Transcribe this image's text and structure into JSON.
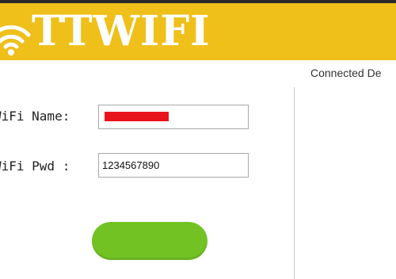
{
  "brand": {
    "title": "TTWIFI",
    "icon": "wifi-icon",
    "banner_color": "#efbf1a"
  },
  "devices_panel": {
    "heading": "Connected De"
  },
  "form": {
    "name_label": "WiFi Name:",
    "name_value": "",
    "name_redacted": true,
    "pwd_label": "WiFi Pwd :",
    "pwd_value": "1234567890"
  },
  "button": {
    "label": "",
    "color": "#72c224"
  },
  "colors": {
    "redaction": "#e8141b",
    "text": "#222222"
  }
}
